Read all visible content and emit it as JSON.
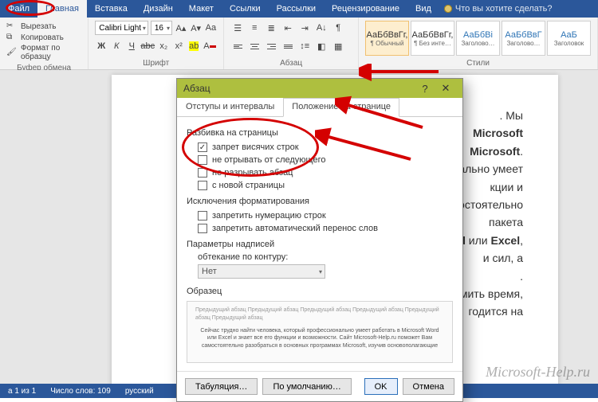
{
  "tabs": {
    "file": "Файл",
    "home": "Главная",
    "insert": "Вставка",
    "design": "Дизайн",
    "layout": "Макет",
    "references": "Ссылки",
    "mailings": "Рассылки",
    "review": "Рецензирование",
    "view": "Вид",
    "tell_me": "Что вы хотите сделать?"
  },
  "clipboard": {
    "group_label": "Буфер обмена",
    "cut": "Вырезать",
    "copy": "Копировать",
    "format_painter": "Формат по образцу"
  },
  "font": {
    "group_label": "Шрифт",
    "family": "Calibri Light",
    "size": "16"
  },
  "paragraph": {
    "group_label": "Абзац"
  },
  "styles": {
    "group_label": "Стили",
    "items": [
      {
        "sample": "АаБбВвГг,",
        "name": "¶ Обычный",
        "sel": true
      },
      {
        "sample": "АаБбВвГг,",
        "name": "¶ Без инте…"
      },
      {
        "sample": "АаБбВі",
        "name": "Заголово…",
        "blue": true
      },
      {
        "sample": "АаБбВвГ",
        "name": "Заголово…",
        "blue": true
      },
      {
        "sample": "АаБ",
        "name": "Заголовок",
        "blue": true
      }
    ]
  },
  "doc": {
    "lines": [
      ". Мы",
      " <b>Microsoft</b>",
      " <b>Microsoft</b>.",
      "ально умеет",
      "кции и",
      "мостоятельно",
      "пакета",
      "<b>rd</b> или <b>Excel</b>,",
      "и сил, а",
      ".",
      "омить время,",
      "годится на"
    ]
  },
  "status": {
    "page": "а 1 из 1",
    "words": "Число слов: 109",
    "lang": "русский"
  },
  "dialog": {
    "title": "Абзац",
    "tabs": {
      "indents": "Отступы и интервалы",
      "position": "Положение на странице"
    },
    "sect_pagination": "Разбивка на страницы",
    "chk_widow": "запрет висячих строк",
    "chk_keep_next": "не отрывать от следующего",
    "chk_keep_together": "не разрывать абзац",
    "chk_page_break": "с новой страницы",
    "sect_formatting": "Исключения форматирования",
    "chk_suppress_num": "запретить нумерацию строк",
    "chk_suppress_hyph": "запретить автоматический перенос слов",
    "sect_textbox": "Параметры надписей",
    "wrap_label": "обтекание по контуру:",
    "wrap_value": "Нет",
    "sect_preview": "Образец",
    "preview_filler1": "Предыдущий абзац Предыдущий абзац Предыдущий абзац Предыдущий абзац Предыдущий абзац Предыдущий абзац",
    "preview_filler2": "Сейчас трудно найти человека, который профессионально умеет работать в Microsoft Word или Excel и знает все его функции и возможности. Сайт Microsoft-Help.ru поможет Вам самостоятельно разобраться в основных программах Microsoft, изучив основополагающие",
    "btn_tabs": "Табуляция…",
    "btn_default": "По умолчанию…",
    "btn_ok": "OK",
    "btn_cancel": "Отмена"
  },
  "watermark": "Microsoft-Help.ru"
}
